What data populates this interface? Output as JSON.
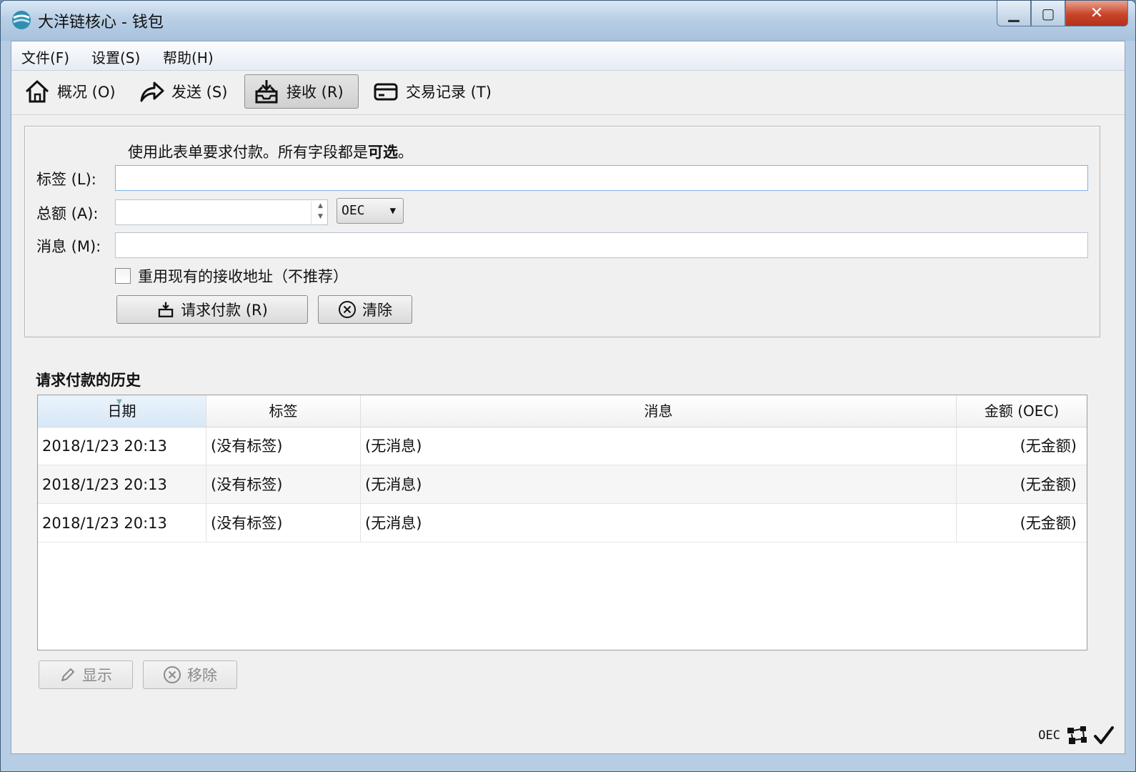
{
  "window": {
    "title": "大洋链核心 - 钱包"
  },
  "menu": [
    "文件(F)",
    "设置(S)",
    "帮助(H)"
  ],
  "toolbar": {
    "overview": "概况 (O)",
    "send": "发送 (S)",
    "receive": "接收 (R)",
    "transactions": "交易记录 (T)"
  },
  "form": {
    "instruction": "使用此表单要求付款。所有字段都是",
    "instruction_bold": "可选",
    "instruction_end": "。",
    "label_label": "标签 (L):",
    "amount_label": "总额 (A):",
    "message_label": "消息 (M):",
    "label_value": "",
    "amount_value": "",
    "message_value": "",
    "unit": "OEC",
    "reuse_checkbox": "重用现有的接收地址（不推荐）",
    "reuse_checked": false,
    "request_button": "请求付款 (R)",
    "clear_button": "清除"
  },
  "history": {
    "title": "请求付款的历史",
    "columns": [
      "日期",
      "标签",
      "消息",
      "金额 (OEC)"
    ],
    "rows": [
      [
        "2018/1/23 20:13",
        "(没有标签)",
        "(无消息)",
        "(无金额)"
      ],
      [
        "2018/1/23 20:13",
        "(没有标签)",
        "(无消息)",
        "(无金额)"
      ],
      [
        "2018/1/23 20:13",
        "(没有标签)",
        "(无消息)",
        "(无金额)"
      ]
    ],
    "show_button": "显示",
    "remove_button": "移除"
  },
  "status": {
    "unit": "OEC"
  },
  "colors": {
    "title_bar": "#b9cfe6",
    "close_button": "#c8442a",
    "client_bg": "#f0f0f0"
  }
}
